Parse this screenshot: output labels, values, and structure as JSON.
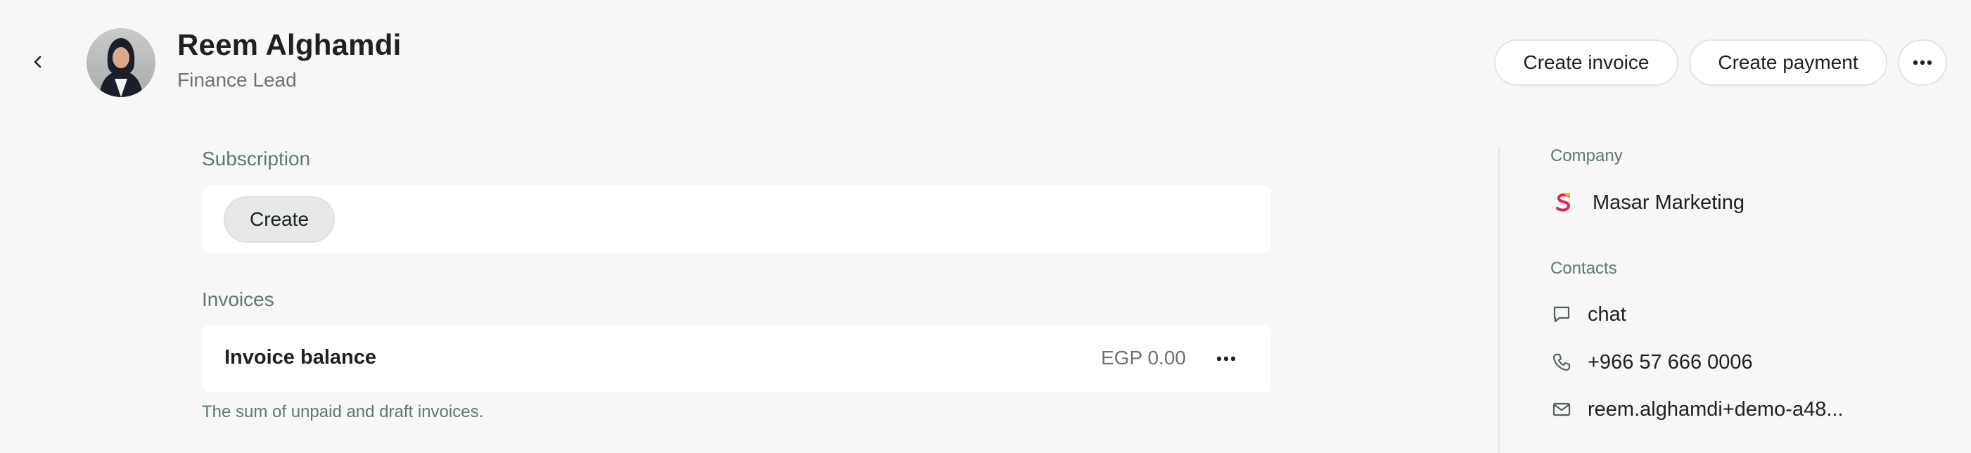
{
  "header": {
    "back_icon": "chevron-left-icon",
    "name": "Reem Alghamdi",
    "role": "Finance Lead",
    "actions": {
      "create_invoice": "Create invoice",
      "create_payment": "Create payment",
      "more_icon": "more-horizontal-icon"
    }
  },
  "subscription": {
    "label": "Subscription",
    "create_label": "Create"
  },
  "invoices": {
    "label": "Invoices",
    "balance_title": "Invoice balance",
    "balance_amount": "EGP 0.00",
    "more_icon": "more-horizontal-icon",
    "note": "The sum of unpaid and draft invoices."
  },
  "sidebar": {
    "company_label": "Company",
    "company_name": "Masar Marketing",
    "company_logo_colors": [
      "#e8234f",
      "#f5a623"
    ],
    "contacts_label": "Contacts",
    "contacts": [
      {
        "icon": "chat-bubble-icon",
        "value": "chat"
      },
      {
        "icon": "phone-icon",
        "value": "+966 57 666 0006"
      },
      {
        "icon": "mail-icon",
        "value": "reem.alghamdi+demo-a48..."
      }
    ]
  },
  "colors": {
    "background": "#f6f7f6",
    "card": "#ffffff",
    "muted_text": "#5f7873",
    "button_border": "#e2e5e3"
  }
}
